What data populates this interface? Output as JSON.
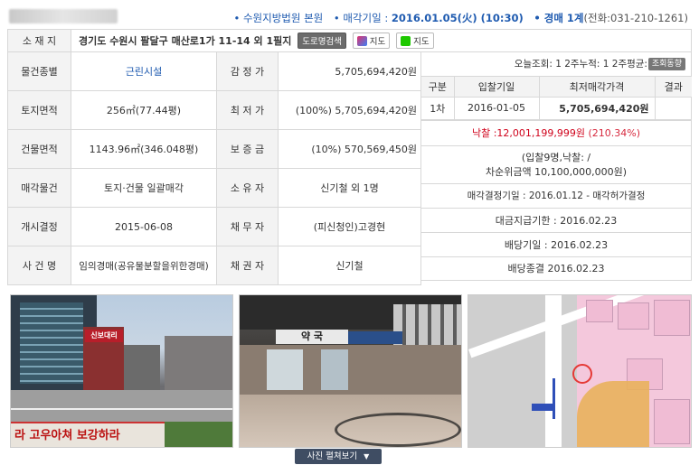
{
  "header": {
    "court_label": "• 수원지방법원 본원",
    "sale_date_label": "• 매각기일 : ",
    "sale_date": "2016.01.05(火) (10:30)",
    "dept_label": "• 경매 1계",
    "phone": "(전화:031-210-1261)"
  },
  "address": {
    "label": "소 재 지",
    "value": "경기도 수원시 팔달구 매산로1가 11-14 외 1필지",
    "road_btn": "도로명검색",
    "map_btn_1": "지도",
    "map_btn_2": "지도"
  },
  "rows": [
    {
      "l1": "물건종별",
      "v1": "근린시설",
      "l2": "감 정 가",
      "v2": "5,705,694,420원"
    },
    {
      "l1": "토지면적",
      "v1": "256㎡(77.44평)",
      "l2": "최 저 가",
      "v2": "(100%) 5,705,694,420원"
    },
    {
      "l1": "건물면적",
      "v1": "1143.96㎡(346.048평)",
      "l2": "보 증 금",
      "v2": "(10%) 570,569,450원"
    },
    {
      "l1": "매각물건",
      "v1": "토지·건물 일괄매각",
      "l2": "소 유 자",
      "v2": "신기철 외 1명"
    },
    {
      "l1": "개시결정",
      "v1": "2015-06-08",
      "l2": "채 무 자",
      "v2": "(피신청인)고경현"
    },
    {
      "l1": "사 건 명",
      "v1": "임의경매(공유물분할을위한경매)",
      "l2": "채 권 자",
      "v2": "신기철"
    }
  ],
  "views": {
    "text": "오늘조회: 1  2주누적: 1  2주평균: 0",
    "badge": "조회동향"
  },
  "bid_table": {
    "headers": [
      "구분",
      "입찰기일",
      "최저매각가격",
      "결과"
    ],
    "row": [
      "1차",
      "2016-01-05",
      "5,705,694,420원",
      ""
    ]
  },
  "result": {
    "sold_label": "낙찰 : ",
    "sold_amount": "12,001,199,999원",
    "sold_pct": "(210.34%)",
    "bidders_line": "(입찰9명,낙찰:              /",
    "second_line": "차순위금액 10,100,000,000원)",
    "decision": "매각결정기일 : 2016.01.12 - 매각허가결정",
    "payment_deadline": "대금지급기한 : 2016.02.23",
    "dividend_date": "배당기일 : 2016.02.23",
    "dividend_end": "배당종결 2016.02.23"
  },
  "photos": {
    "photo1_caption": "",
    "photo1_sign": "신보대리",
    "photo1_banner": "라 고우아쳐 보강하라",
    "photo2_sign": "약 국",
    "expand_label": "사진 펼쳐보기"
  },
  "colors": {
    "accent_blue": "#1f5bb0",
    "sold_red": "#d0021b",
    "label_bg": "#f3f3f3",
    "border": "#d8d8d8"
  }
}
